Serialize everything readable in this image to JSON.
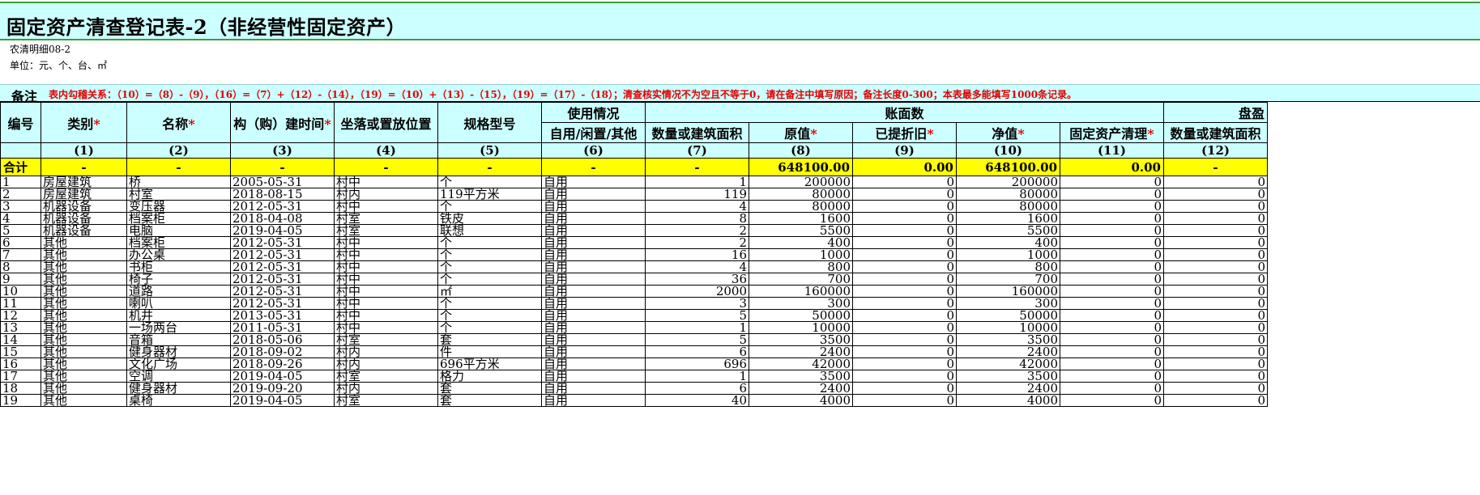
{
  "title": "固定资产清查登记表-2（非经营性固定资产）",
  "subtitle_code": "农清明细08-2",
  "unit": "单位：元、个、台、㎡",
  "note": {
    "label": "备注",
    "text": "表内勾稽关系：（10）=（8）-（9），（16）=（7）+（12）-（14），（19）=（10）+（13）-（15），（19）=（17）-（18）；清查核实情况不为空且不等于0，请在备注中填写原因；备注长度0-300；本表最多能填写1000条记录。"
  },
  "headers": {
    "no": "编号",
    "category": "类别",
    "name": "名称",
    "build_time": "构（购）建时间",
    "location": "坐落或置放位置",
    "spec": "规格型号",
    "usage_group": "使用情况",
    "usage": "自用/闲置/其他",
    "book_group": "账面数",
    "qty": "数量或建筑面积",
    "original": "原值",
    "depreciation": "已提折旧",
    "net": "净值",
    "cleanup": "固定资产清理",
    "surplus_group": "盘盈",
    "surplus_qty": "数量或建筑面积",
    "star": "*"
  },
  "col_numbers": [
    "(1)",
    "(2)",
    "(3)",
    "(4)",
    "(5)",
    "(6)",
    "(7)",
    "(8)",
    "(9)",
    "(10)",
    "(11)",
    "(12)"
  ],
  "total": {
    "label": "合计",
    "cells": [
      "-",
      "-",
      "-",
      "-",
      "-",
      "-",
      "-",
      "648100.00",
      "0.00",
      "648100.00",
      "0.00",
      "-"
    ]
  },
  "rows": [
    [
      "1",
      "房屋建筑",
      "桥",
      "2005-05-31",
      "村中",
      "个",
      "自用",
      "1",
      "200000",
      "0",
      "200000",
      "0",
      "0"
    ],
    [
      "2",
      "房屋建筑",
      "村室",
      "2018-08-15",
      "村内",
      "119平方米",
      "自用",
      "119",
      "80000",
      "0",
      "80000",
      "0",
      "0"
    ],
    [
      "3",
      "机器设备",
      "变压器",
      "2012-05-31",
      "村中",
      "个",
      "自用",
      "4",
      "80000",
      "0",
      "80000",
      "0",
      "0"
    ],
    [
      "4",
      "机器设备",
      "档案柜",
      "2018-04-08",
      "村室",
      "铁皮",
      "自用",
      "8",
      "1600",
      "0",
      "1600",
      "0",
      "0"
    ],
    [
      "5",
      "机器设备",
      "电脑",
      "2019-04-05",
      "村室",
      "联想",
      "自用",
      "2",
      "5500",
      "0",
      "5500",
      "0",
      "0"
    ],
    [
      "6",
      "其他",
      "档案柜",
      "2012-05-31",
      "村中",
      "个",
      "自用",
      "2",
      "400",
      "0",
      "400",
      "0",
      "0"
    ],
    [
      "7",
      "其他",
      "办公桌",
      "2012-05-31",
      "村中",
      "个",
      "自用",
      "16",
      "1000",
      "0",
      "1000",
      "0",
      "0"
    ],
    [
      "8",
      "其他",
      "书柜",
      "2012-05-31",
      "村中",
      "个",
      "自用",
      "4",
      "800",
      "0",
      "800",
      "0",
      "0"
    ],
    [
      "9",
      "其他",
      "椅子",
      "2012-05-31",
      "村中",
      "个",
      "自用",
      "36",
      "700",
      "0",
      "700",
      "0",
      "0"
    ],
    [
      "10",
      "其他",
      "道路",
      "2012-05-31",
      "村中",
      "㎡",
      "自用",
      "2000",
      "160000",
      "0",
      "160000",
      "0",
      "0"
    ],
    [
      "11",
      "其他",
      "喇叭",
      "2012-05-31",
      "村中",
      "个",
      "自用",
      "3",
      "300",
      "0",
      "300",
      "0",
      "0"
    ],
    [
      "12",
      "其他",
      "机井",
      "2013-05-31",
      "村中",
      "个",
      "自用",
      "5",
      "50000",
      "0",
      "50000",
      "0",
      "0"
    ],
    [
      "13",
      "其他",
      "一场两台",
      "2011-05-31",
      "村中",
      "个",
      "自用",
      "1",
      "10000",
      "0",
      "10000",
      "0",
      "0"
    ],
    [
      "14",
      "其他",
      "音箱",
      "2018-05-06",
      "村室",
      "套",
      "自用",
      "5",
      "3500",
      "0",
      "3500",
      "0",
      "0"
    ],
    [
      "15",
      "其他",
      "健身器材",
      "2018-09-02",
      "村内",
      "件",
      "自用",
      "6",
      "2400",
      "0",
      "2400",
      "0",
      "0"
    ],
    [
      "16",
      "其他",
      "文化广场",
      "2018-09-26",
      "村内",
      "696平方米",
      "自用",
      "696",
      "42000",
      "0",
      "42000",
      "0",
      "0"
    ],
    [
      "17",
      "其他",
      "空调",
      "2019-04-05",
      "村室",
      "格力",
      "自用",
      "1",
      "3500",
      "0",
      "3500",
      "0",
      "0"
    ],
    [
      "18",
      "其他",
      "健身器材",
      "2019-09-20",
      "村内",
      "套",
      "自用",
      "6",
      "2400",
      "0",
      "2400",
      "0",
      "0"
    ],
    [
      "19",
      "其他",
      "桌椅",
      "2019-04-05",
      "村室",
      "套",
      "自用",
      "40",
      "4000",
      "0",
      "4000",
      "0",
      "0"
    ]
  ]
}
